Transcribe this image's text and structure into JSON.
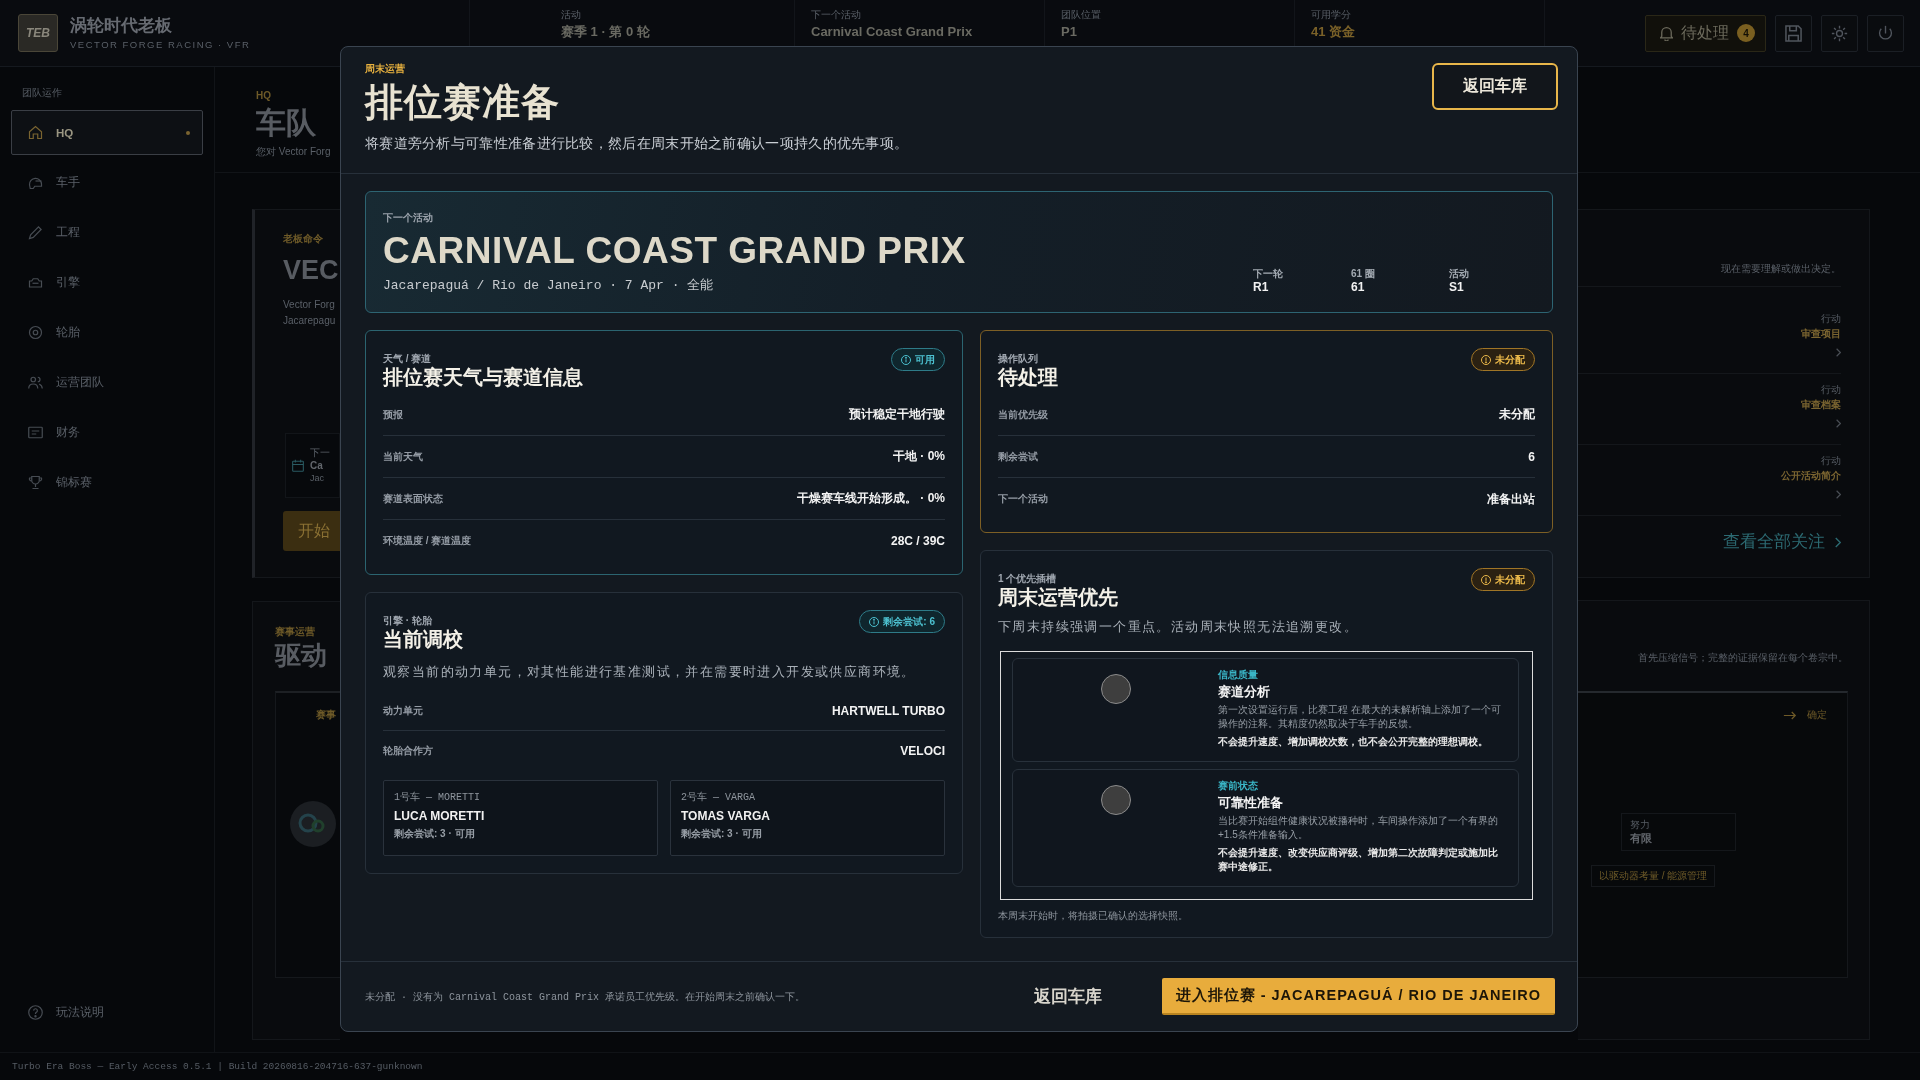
{
  "app": {
    "logo": "TEB",
    "title": "涡轮时代老板",
    "subtitle": "VECTOR FORGE RACING · VFR",
    "stats": [
      {
        "label": "活动",
        "value": "赛季 1 · 第 0 轮"
      },
      {
        "label": "下一个活动",
        "value": "Carnival Coast Grand Prix"
      },
      {
        "label": "团队位置",
        "value": "P1"
      },
      {
        "label": "可用学分",
        "value": "41 资金"
      }
    ],
    "pending_button": {
      "label": "待处理",
      "count": "4"
    }
  },
  "sidebar": {
    "section": "团队运作",
    "items": [
      {
        "label": "HQ",
        "selected": true
      },
      {
        "label": "车手",
        "selected": false
      },
      {
        "label": "工程",
        "selected": false
      },
      {
        "label": "引擎",
        "selected": false
      },
      {
        "label": "轮胎",
        "selected": false
      },
      {
        "label": "运营团队",
        "selected": false
      },
      {
        "label": "财务",
        "selected": false
      },
      {
        "label": "锦标赛",
        "selected": false
      }
    ],
    "help": "玩法说明"
  },
  "page_behind": {
    "section": "HQ",
    "title": "车队",
    "subtitle": "您对 Vector Forg",
    "order_card": {
      "label": "老板命令",
      "title": "VEC",
      "lines": [
        "Vector Forg",
        "Jacarepagu"
      ],
      "event": {
        "label": "下一",
        "name": "Ca",
        "place": "Jac"
      },
      "button": "开始"
    },
    "operations_card": {
      "label": "赛事运营",
      "title": "驱动",
      "panel_label": "赛事"
    },
    "attention_card": {
      "note": "现在需要理解或做出决定。",
      "actions": [
        {
          "label": "行动",
          "value": "审查项目"
        },
        {
          "label": "行动",
          "value": "审查档案"
        },
        {
          "label": "行动",
          "value": "公开活动简介"
        }
      ],
      "link": "查看全部关注"
    },
    "signals_card": {
      "note": "首先压缩信号；完整的证据保留在每个卷宗中。",
      "confirm": "确定",
      "effort": {
        "label": "努力",
        "value": "有限"
      },
      "tag": "以驱动器考量 / 能源管理"
    }
  },
  "build_info": "Turbo Era Boss — Early Access 0.5.1 | Build 20260816-204716-637-gunknown",
  "modal": {
    "eyebrow": "周末运营",
    "title": "排位赛准备",
    "description": "将赛道旁分析与可靠性准备进行比较，然后在周末开始之前确认一项持久的优先事项。",
    "close_button": "返回车库",
    "event": {
      "label": "下一个活动",
      "name": "CARNIVAL COAST GRAND PRIX",
      "details": "Jacarepaguá / Rio de Janeiro · 7 Apr · 全能",
      "stats": [
        {
          "label": "下一轮",
          "value": "R1"
        },
        {
          "label": "61 圈",
          "value": "61"
        },
        {
          "label": "活动",
          "value": "S1"
        }
      ]
    },
    "weather": {
      "eyebrow": "天气 / 赛道",
      "title": "排位赛天气与赛道信息",
      "badge": {
        "kind": "info",
        "text": "可用"
      },
      "rows": [
        {
          "label": "预报",
          "value": "预计稳定干地行驶"
        },
        {
          "label": "当前天气",
          "value": "干地 · 0%"
        },
        {
          "label": "赛道表面状态",
          "value": "干燥赛车线开始形成。 · 0%"
        },
        {
          "label": "环境温度 / 赛道温度",
          "value": "28C / 39C"
        }
      ]
    },
    "tuning": {
      "eyebrow": "引擎 · 轮胎",
      "title": "当前调校",
      "badge": {
        "kind": "info",
        "text": "剩余尝试: 6"
      },
      "description": "观察当前的动力单元，对其性能进行基准测试，并在需要时进入开发或供应商环境。",
      "rows": [
        {
          "label": "动力单元",
          "value": "HARTWELL TURBO"
        },
        {
          "label": "轮胎合作方",
          "value": "VELOCI"
        }
      ],
      "drivers": [
        {
          "car": "1号车 — MORETTI",
          "name": "LUCA MORETTI",
          "status": "剩余尝试: 3 · 可用"
        },
        {
          "car": "2号车 — VARGA",
          "name": "TOMAS VARGA",
          "status": "剩余尝试: 3 · 可用"
        }
      ]
    },
    "pending": {
      "eyebrow": "操作队列",
      "title": "待处理",
      "badge": {
        "kind": "warning",
        "text": "未分配"
      },
      "rows": [
        {
          "label": "当前优先级",
          "value": "未分配"
        },
        {
          "label": "剩余尝试",
          "value": "6"
        },
        {
          "label": "下一个活动",
          "value": "准备出站"
        }
      ]
    },
    "priorities": {
      "eyebrow": "1 个优先插槽",
      "title": "周末运营优先",
      "badge": {
        "kind": "warning",
        "text": "未分配"
      },
      "description": "下周末持续强调一个重点。活动周末快照无法追溯更改。",
      "options": [
        {
          "category": "信息质量",
          "title": "赛道分析",
          "description": "第一次设置运行后，比赛工程 在最大的未解析轴上添加了一个可操作的注释。其精度仍然取决于车手的反馈。",
          "note": "不会提升速度、增加调校次数，也不会公开完整的理想调校。",
          "selected": false
        },
        {
          "category": "赛前状态",
          "title": "可靠性准备",
          "description": "当比赛开始组件健康状况被播种时，车间操作添加了一个有界的 +1.5条件准备输入。",
          "note": "不会提升速度、改变供应商评级、增加第二次故障判定或施加比赛中途修正。",
          "selected": false
        }
      ],
      "footnote": "本周末开始时，将拍摄已确认的选择快照。"
    },
    "footer": {
      "note": "未分配 · 没有为 Carnival Coast Grand Prix 承诺员工优先级。在开始周末之前确认一下。",
      "back_button": "返回车库",
      "primary_button": "进入排位赛 - JACAREPAGUÁ / RIO DE JANEIRO"
    }
  }
}
